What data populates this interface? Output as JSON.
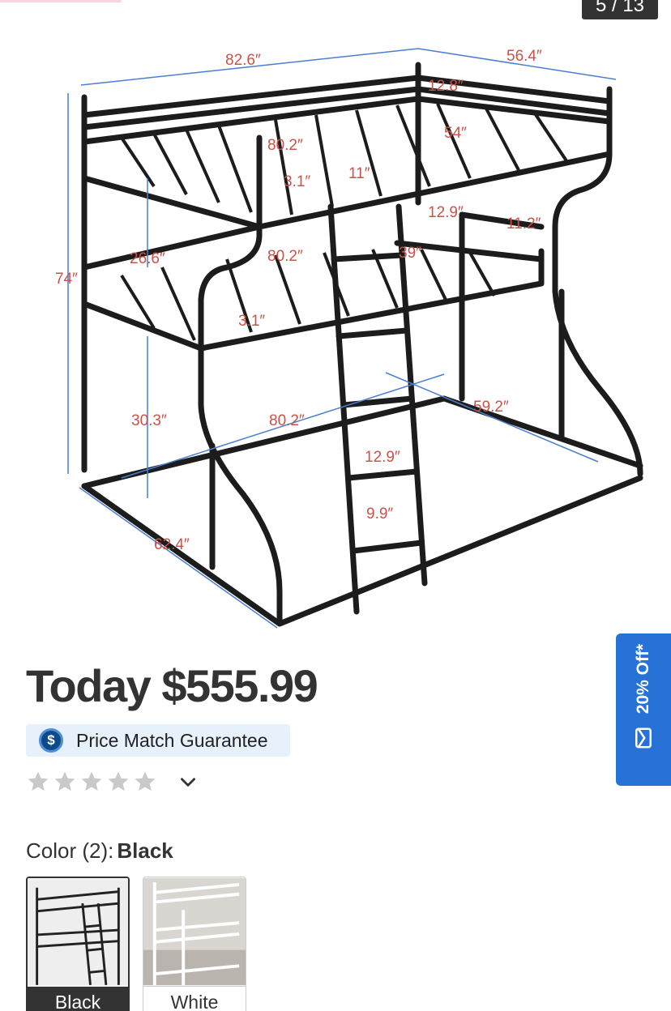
{
  "gallery": {
    "counter": "5 / 13",
    "dimensions": [
      "82.6″",
      "56.4″",
      "12.8″",
      "80.2″",
      "54″",
      "3.1″",
      "11″",
      "12.9″",
      "11.2″",
      "26.6″",
      "80.2″",
      "39″",
      "74″",
      "3.1″",
      "30.3″",
      "80.2″",
      "59.2″",
      "12.9″",
      "9.9″",
      "62.4″"
    ]
  },
  "product": {
    "price_text": "Today $555.99",
    "price_match": {
      "icon_glyph": "$",
      "label": "Price Match Guarantee"
    },
    "rating": {
      "stars_filled": 0,
      "stars_total": 5,
      "toggle_icon": "chevron-down-icon"
    }
  },
  "color": {
    "label": "Color (2):",
    "selected": "Black",
    "options": [
      {
        "label": "Black",
        "frame_color": "#222222"
      },
      {
        "label": "White",
        "frame_color": "#f2f2f2"
      }
    ]
  },
  "promo": {
    "text": "20% Off*",
    "icon": "envelope-icon",
    "color": "#2672d6"
  }
}
